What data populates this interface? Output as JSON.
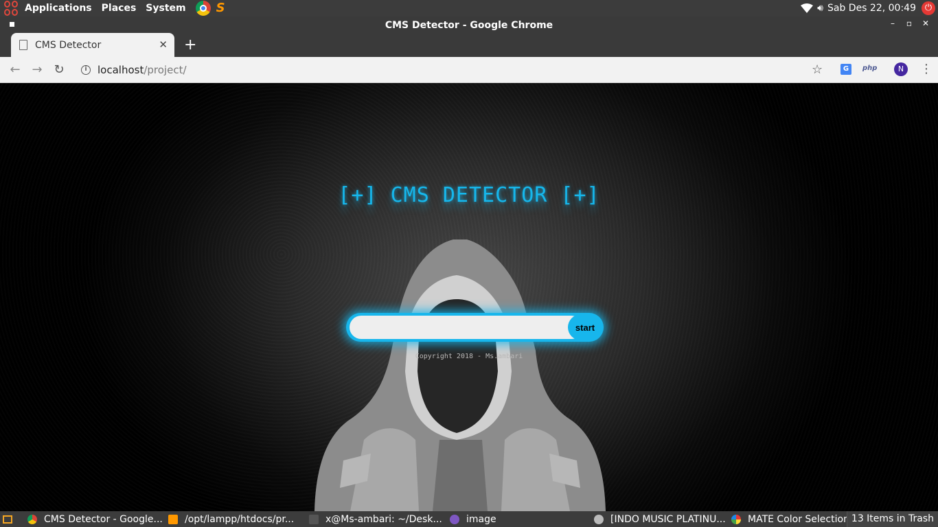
{
  "top_panel": {
    "menu": [
      "Applications",
      "Places",
      "System"
    ],
    "clock": "Sab Des 22, 00:49"
  },
  "window": {
    "title": "CMS Detector - Google Chrome"
  },
  "tab": {
    "title": "CMS Detector"
  },
  "address_bar": {
    "host": "localhost",
    "path": "/project/",
    "avatar_letter": "N",
    "php_ext_label": "php"
  },
  "page": {
    "title": "[+] CMS DETECTOR [+]",
    "search_placeholder": "",
    "start_label": "start",
    "copyright": "Copyright 2018 - Ms.ambari",
    "accent_color": "#17b6ec"
  },
  "taskbar": {
    "tasks": [
      {
        "label": "CMS Detector - Google...",
        "icon": "chrome-icon"
      },
      {
        "label": "/opt/lampp/htdocs/pr...",
        "icon": "sublime-icon"
      },
      {
        "label": "x@Ms-ambari: ~/Desk...",
        "icon": "terminal-icon"
      },
      {
        "label": "image",
        "icon": "image-viewer-icon"
      },
      {
        "label": "[INDO MUSIC PLATINU...",
        "icon": "media-player-icon"
      },
      {
        "label": "MATE Color Selection",
        "icon": "color-selection-icon"
      }
    ],
    "trash": "13 Items in Trash"
  }
}
